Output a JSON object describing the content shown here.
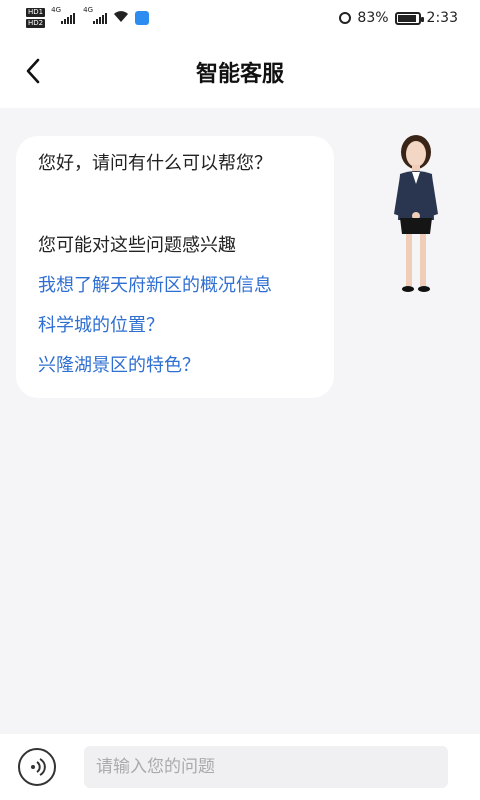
{
  "status_bar": {
    "battery": "83%",
    "time": "2:33",
    "network": [
      "4G",
      "4G"
    ],
    "hd_badges": [
      "HD1",
      "HD2"
    ],
    "icons": [
      "signal-icon",
      "wifi-icon",
      "app-icon",
      "alarm-icon",
      "battery-icon"
    ]
  },
  "header": {
    "title": "智能客服",
    "back_icon": "chevron-left-icon"
  },
  "chat": {
    "greeting": "您好，请问有什么可以帮您？",
    "suggest_lead": "您可能对这些问题感兴趣",
    "questions": [
      "我想了解天府新区的概况信息",
      "科学城的位置？",
      "兴隆湖景区的特色？"
    ]
  },
  "input": {
    "placeholder": "请输入您的问题",
    "voice_icon": "voice-icon"
  },
  "colors": {
    "link": "#2f6fd1",
    "background": "#f5f5f7"
  }
}
